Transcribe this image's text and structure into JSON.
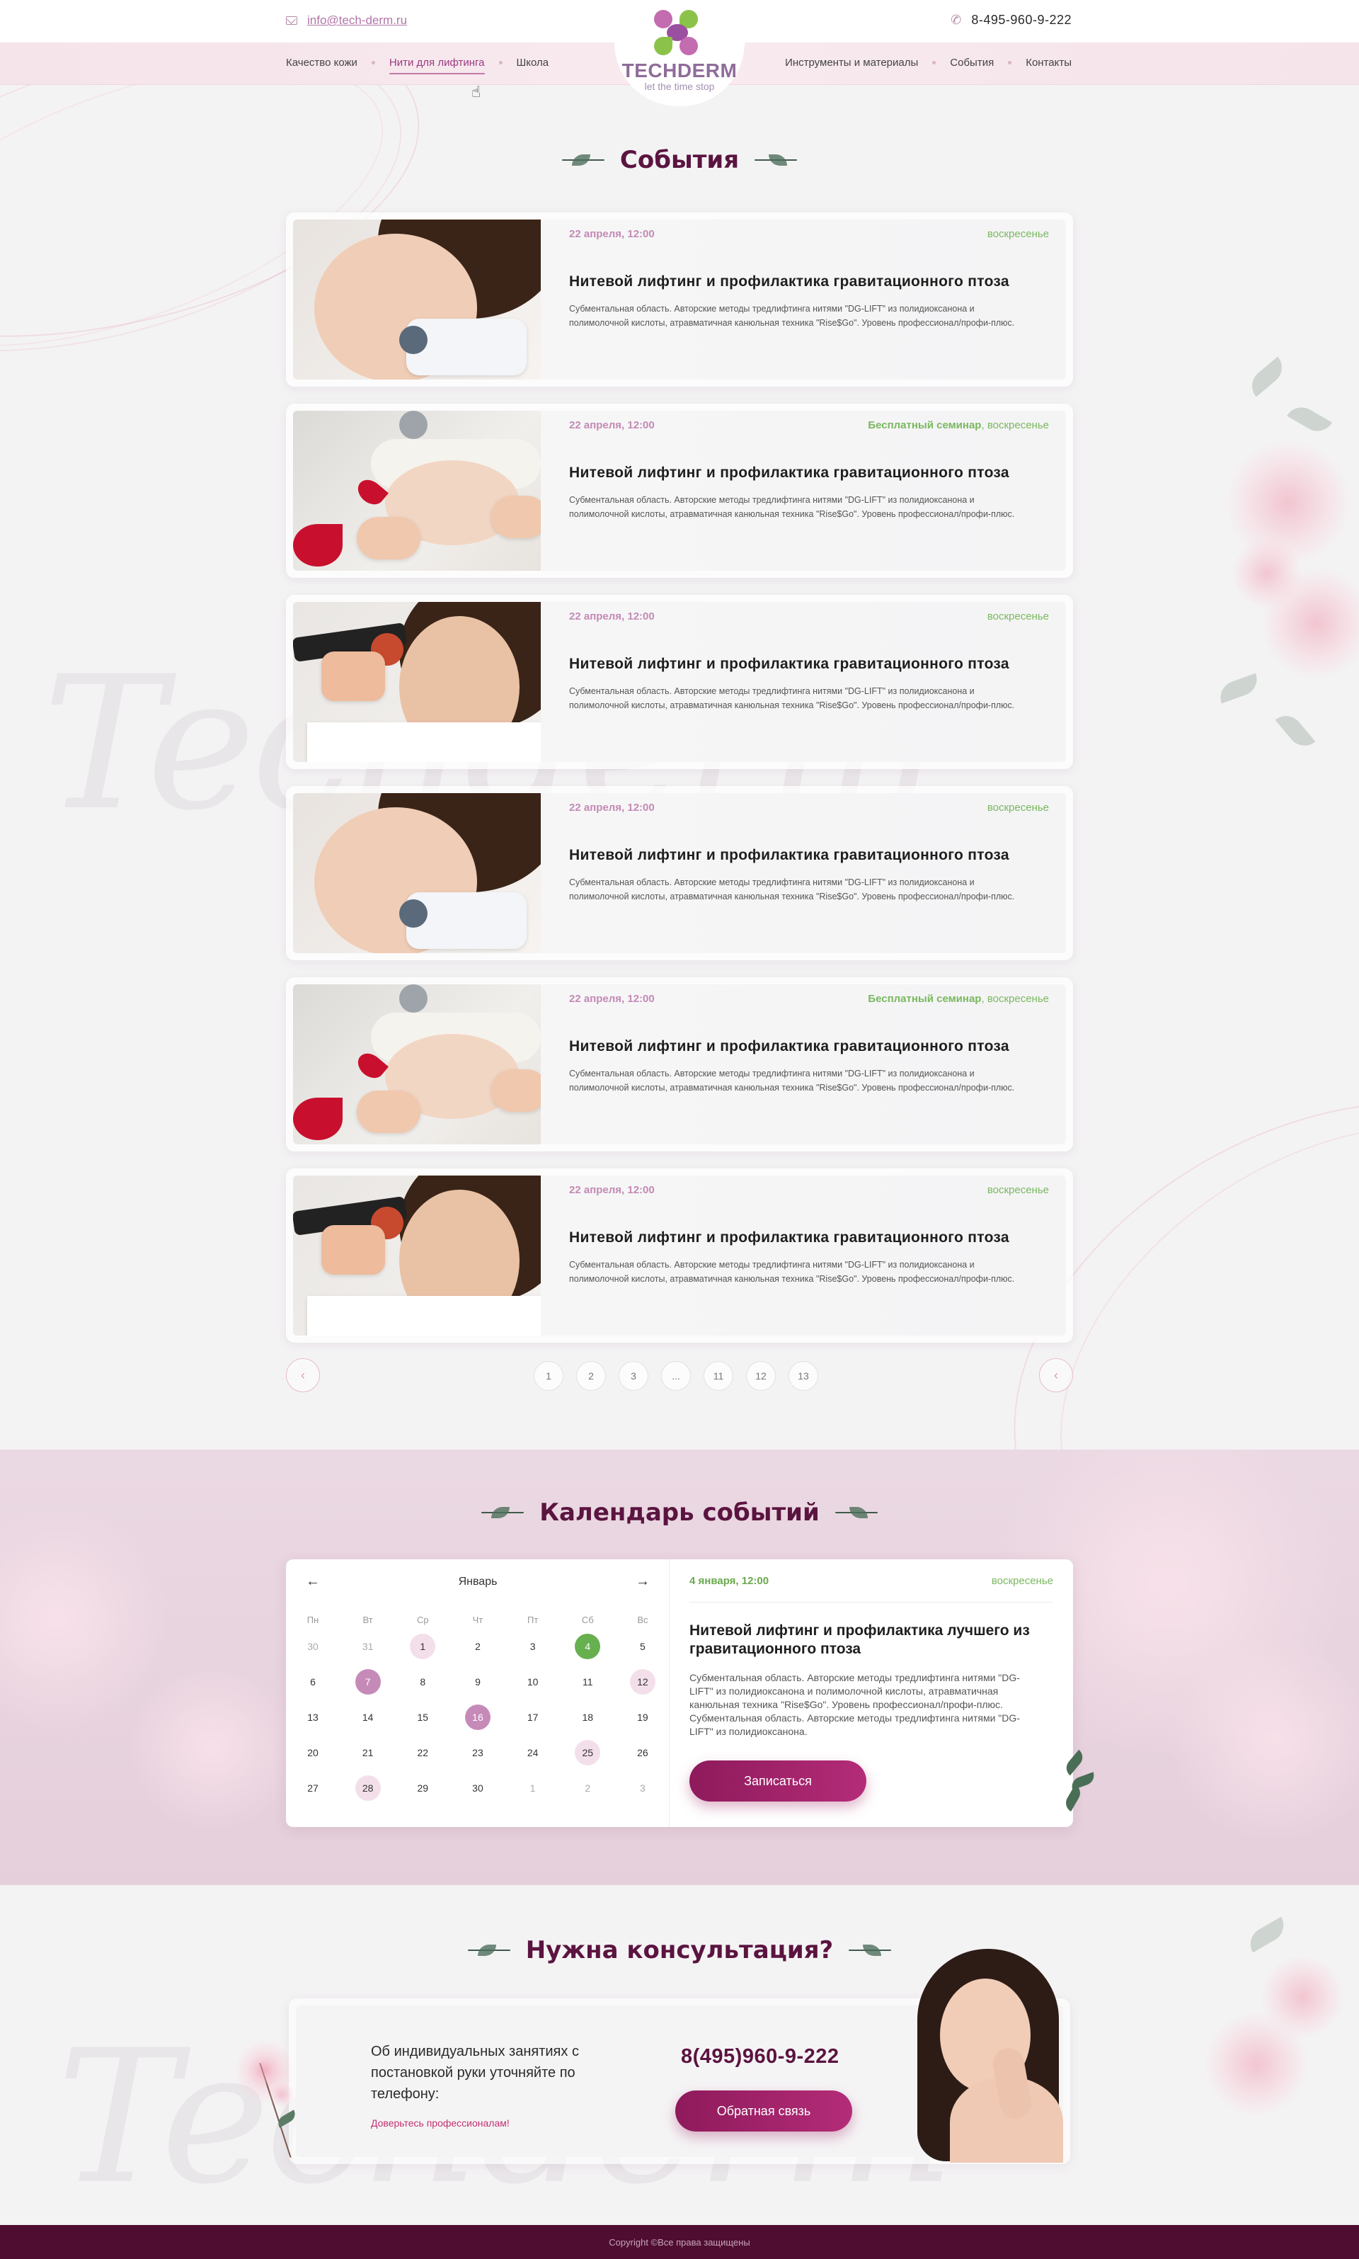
{
  "header": {
    "email": "info@tech-derm.ru",
    "phone": "8-495-960-9-222",
    "nav_left": [
      {
        "label": "Качество кожи",
        "active": false
      },
      {
        "label": "Нити для лифтинга",
        "active": true
      },
      {
        "label": "Школа",
        "active": false
      }
    ],
    "nav_right": [
      {
        "label": "Инструменты и материалы"
      },
      {
        "label": "События"
      },
      {
        "label": "Контакты"
      }
    ],
    "logo": {
      "title": "TECHDERM",
      "tagline": "let the time stop"
    }
  },
  "events_section": {
    "title": "События",
    "items": [
      {
        "date": "22 апреля, 12:00",
        "tag_bold": "",
        "tag": "воскресенье",
        "title": "Нитевой лифтинг и профилактика гравитационного птоза",
        "description": "Субментальная область. Авторские методы тредлифтинга нитями \"DG-LIFT\" из полидиоксанона и полимолочной кислоты, атравматичная канюльная техника \"Rise$Go\". Уровень профессионал/профи-плюс.",
        "photo_icon": "face-treatment-photo"
      },
      {
        "date": "22 апреля, 12:00",
        "tag_bold": "Бесплатный семинар",
        "tag": ", воскресенье",
        "title": "Нитевой лифтинг и профилактика гравитационного птоза",
        "description": "Субментальная область. Авторские методы тредлифтинга нитями \"DG-LIFT\" из полидиоксанона и полимолочной кислоты, атравматичная канюльная техника \"Rise$Go\". Уровень профессионал/профи-плюс.",
        "photo_icon": "spa-massage-photo"
      },
      {
        "date": "22 апреля, 12:00",
        "tag_bold": "",
        "tag": "воскресенье",
        "title": "Нитевой лифтинг и профилактика гравитационного птоза",
        "description": "Субментальная область. Авторские методы тредлифтинга нитями \"DG-LIFT\" из полидиоксанона и полимолочной кислоты, атравматичная канюльная техника \"Rise$Go\". Уровень профессионал/профи-плюс.",
        "photo_icon": "device-treatment-photo"
      },
      {
        "date": "22 апреля, 12:00",
        "tag_bold": "",
        "tag": "воскресенье",
        "title": "Нитевой лифтинг и профилактика гравитационного птоза",
        "description": "Субментальная область. Авторские методы тредлифтинга нитями \"DG-LIFT\" из полидиоксанона и полимолочной кислоты, атравматичная канюльная техника \"Rise$Go\". Уровень профессионал/профи-плюс.",
        "photo_icon": "face-treatment-photo"
      },
      {
        "date": "22 апреля, 12:00",
        "tag_bold": "Бесплатный семинар",
        "tag": ", воскресенье",
        "title": "Нитевой лифтинг и профилактика гравитационного птоза",
        "description": "Субментальная область. Авторские методы тредлифтинга нитями \"DG-LIFT\" из полидиоксанона и полимолочной кислоты, атравматичная канюльная техника \"Rise$Go\". Уровень профессионал/профи-плюс.",
        "photo_icon": "spa-massage-photo"
      },
      {
        "date": "22 апреля, 12:00",
        "tag_bold": "",
        "tag": "воскресенье",
        "title": "Нитевой лифтинг и профилактика гравитационного птоза",
        "description": "Субментальная область. Авторские методы тредлифтинга нитями \"DG-LIFT\" из полидиоксанона и полимолочной кислоты, атравматичная канюльная техника \"Rise$Go\". Уровень профессионал/профи-плюс.",
        "photo_icon": "device-treatment-photo"
      }
    ]
  },
  "pagination": {
    "prev_icon": "chevron-left-icon",
    "next_icon": "chevron-left-icon",
    "pages": [
      "1",
      "2",
      "3",
      "...",
      "11",
      "12",
      "13"
    ]
  },
  "calendar_section": {
    "title": "Календарь событий",
    "month": "Январь",
    "weekdays": [
      "Пн",
      "Вт",
      "Ср",
      "Чт",
      "Пт",
      "Сб",
      "Вс"
    ],
    "weeks": [
      [
        {
          "d": "30",
          "s": "dim"
        },
        {
          "d": "31",
          "s": "dim"
        },
        {
          "d": "1",
          "s": "light"
        },
        {
          "d": "2",
          "s": ""
        },
        {
          "d": "3",
          "s": ""
        },
        {
          "d": "4",
          "s": "green"
        },
        {
          "d": "5",
          "s": ""
        }
      ],
      [
        {
          "d": "6",
          "s": ""
        },
        {
          "d": "7",
          "s": "purple"
        },
        {
          "d": "8",
          "s": ""
        },
        {
          "d": "9",
          "s": ""
        },
        {
          "d": "10",
          "s": ""
        },
        {
          "d": "11",
          "s": ""
        },
        {
          "d": "12",
          "s": "light"
        }
      ],
      [
        {
          "d": "13",
          "s": ""
        },
        {
          "d": "14",
          "s": ""
        },
        {
          "d": "15",
          "s": ""
        },
        {
          "d": "16",
          "s": "purple"
        },
        {
          "d": "17",
          "s": ""
        },
        {
          "d": "18",
          "s": ""
        },
        {
          "d": "19",
          "s": ""
        }
      ],
      [
        {
          "d": "20",
          "s": ""
        },
        {
          "d": "21",
          "s": ""
        },
        {
          "d": "22",
          "s": ""
        },
        {
          "d": "23",
          "s": ""
        },
        {
          "d": "24",
          "s": ""
        },
        {
          "d": "25",
          "s": "light"
        },
        {
          "d": "26",
          "s": ""
        }
      ],
      [
        {
          "d": "27",
          "s": ""
        },
        {
          "d": "28",
          "s": "light"
        },
        {
          "d": "29",
          "s": ""
        },
        {
          "d": "30",
          "s": ""
        },
        {
          "d": "1",
          "s": "dim"
        },
        {
          "d": "2",
          "s": "dim"
        },
        {
          "d": "3",
          "s": "dim"
        }
      ]
    ],
    "event": {
      "date": "4 января, 12:00",
      "tag": "воскресенье",
      "title": "Нитевой лифтинг и профилактика лучшего из гравитационного птоза",
      "description": "Субментальная область. Авторские методы тредлифтинга нитями \"DG-LIFT\" из полидиоксанона и полимолочной кислоты, атравматичная канюльная техника \"Rise$Go\". Уровень профессионал/профи-плюс. Субментальная область. Авторские методы тредлифтинга нитями \"DG-LIFT\" из полидиоксанона.",
      "button": "Записаться"
    }
  },
  "consult_section": {
    "title": "Нужна консультация?",
    "text": "Об индивидуальных занятиях с постановкой руки уточняйте по телефону:",
    "note": "Доверьтесь профессионалам!",
    "phone": "8(495)960-9-222",
    "button": "Обратная связь"
  },
  "footer": {
    "copyright": "Copyright ©Все права защищены"
  },
  "colors": {
    "brand": "#5b1440",
    "accent": "#b42c78",
    "green": "#67b04f",
    "pink": "#c68ab8"
  }
}
